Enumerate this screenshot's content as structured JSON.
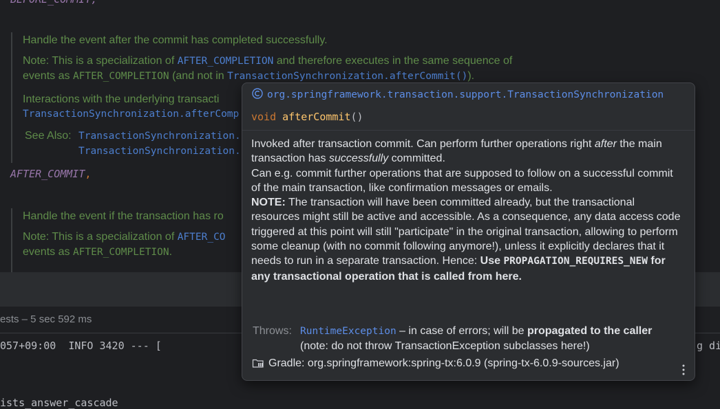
{
  "editor": {
    "top_partial": "BEFORE_COMMIT,",
    "block1": {
      "line1": "Handle the event after the commit has completed successfully.",
      "note_prefix": "Note: This is a specialization of ",
      "note_code1": "AFTER_COMPLETION",
      "note_mid": " and therefore executes in the same sequence of",
      "line3_prefix": "events as ",
      "line3_code": "AFTER_COMPLETION",
      "line3_mid": " (and not in ",
      "line3_link": "TransactionSynchronization.afterCommit()",
      "line3_end": ").",
      "interactions": "Interactions with the underlying transacti",
      "interactions_link": "TransactionSynchronization.afterComp",
      "see_also_label": "See Also:",
      "see_also_link1": "TransactionSynchronization.",
      "see_also_link2": "TransactionSynchronization."
    },
    "enum_after_commit": "AFTER_COMMIT",
    "enum_comma": ",",
    "block2": {
      "line1": "Handle the event if the transaction has ro",
      "note_prefix": "Note: This is a specialization of ",
      "note_code": "AFTER_CO",
      "line2_prefix": "events as ",
      "line2_code": "AFTER_COMPLETION",
      "line2_end": "."
    }
  },
  "run_bar": {
    "text": "ests – 5 sec 592 ms"
  },
  "console": {
    "line1": "057+09:00  INFO 3420 --- [",
    "line1_right": "g di",
    "line2": "ists_answer_cascade"
  },
  "popup": {
    "header_icon": "class-c-icon",
    "header_package": "org.springframework.transaction.support.TransactionSynchronization",
    "signature": {
      "keyword": "void",
      "name": "afterCommit",
      "params": "()"
    },
    "description": {
      "p1_a": "Invoked after transaction commit. Can perform further operations right ",
      "p1_em1": "after",
      "p1_b": " the main transaction has ",
      "p1_em2": "successfully",
      "p1_c": " committed.",
      "p2": "Can e.g. commit further operations that are supposed to follow on a successful commit of the main transaction, like confirmation messages or emails.",
      "p3_bold": "NOTE:",
      "p3_text": " The transaction will have been committed already, but the transactional resources might still be active and accessible. As a consequence, any data access code triggered at this point will still \"participate\" in the original transaction, allowing to perform some cleanup (with no commit following anymore!), unless it explicitly declares that it needs to run in a separate transaction. Hence: ",
      "p3_bold2": "Use ",
      "p3_code": "PROPAGATION_REQUIRES_NEW",
      "p3_bold3": " for any transactional operation that is called from here."
    },
    "throws": {
      "label": "Throws:",
      "exception": "RuntimeException",
      "text_a": " – in case of errors; will be ",
      "text_bold": "propagated to the caller",
      "text_b": " (note: do not throw TransactionException subclasses here!)"
    },
    "gradle": {
      "icon": "library-folder-icon",
      "text": "Gradle: org.springframework:spring-tx:6.0.9 (spring-tx-6.0.9-sources.jar)"
    },
    "menu_icon": "more-vertical-icon"
  },
  "colors": {
    "background": "#1e1f22",
    "popup_background": "#2b2d30",
    "doc_comment_green": "#5f8c4a",
    "link_blue": "#5d8ee8",
    "keyword_orange": "#cc7832",
    "method_yellow": "#ffc66d",
    "enum_purple": "#9876aa"
  }
}
